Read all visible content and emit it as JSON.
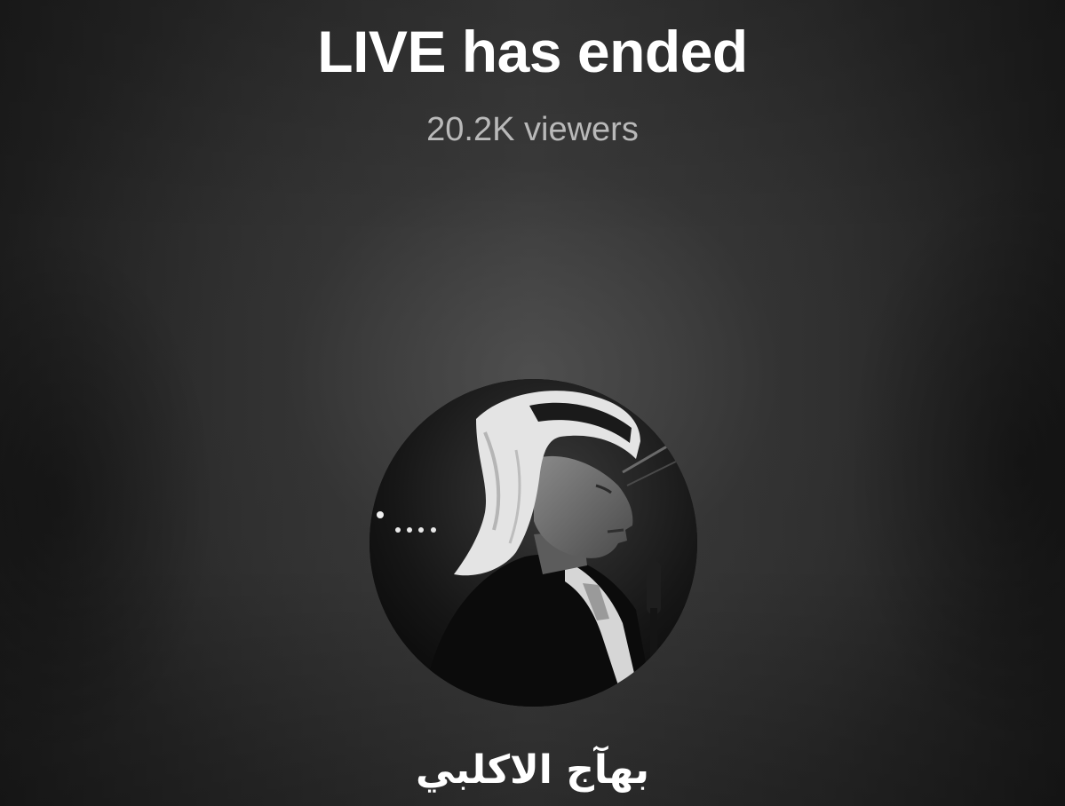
{
  "live_ended": {
    "title": "LIVE has ended",
    "viewers_text": "20.2K viewers",
    "host": {
      "username": "بهآج الاكلبي",
      "avatar_icon": "profile-photo"
    }
  },
  "colors": {
    "title": "#ffffff",
    "viewers": "#b9b9b9",
    "background": "#2e2e2e"
  }
}
